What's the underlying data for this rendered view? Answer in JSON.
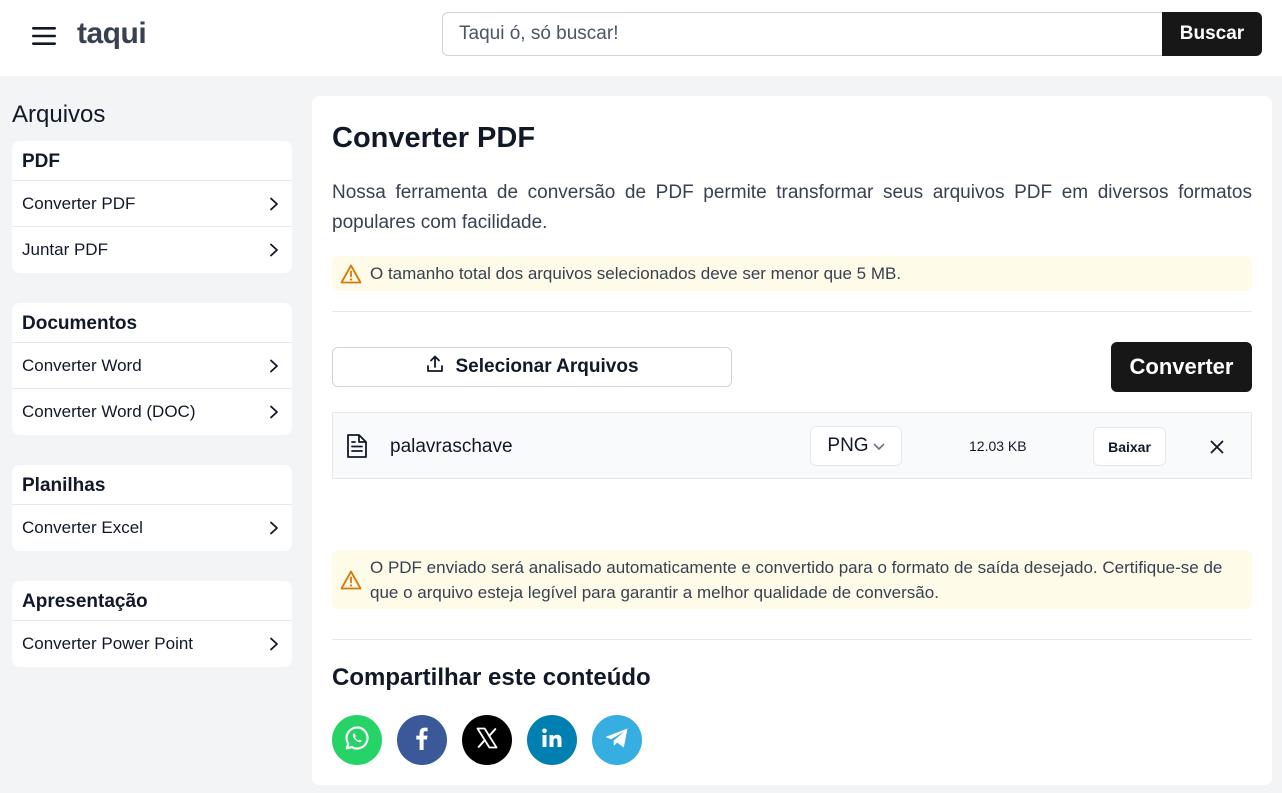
{
  "header": {
    "logo": "taqui",
    "search_placeholder": "Taqui ó, só buscar!",
    "search_button": "Buscar"
  },
  "sidebar": {
    "title": "Arquivos",
    "groups": [
      {
        "title": "PDF",
        "items": [
          "Converter PDF",
          "Juntar PDF"
        ]
      },
      {
        "title": "Documentos",
        "items": [
          "Converter Word",
          "Converter Word (DOC)"
        ]
      },
      {
        "title": "Planilhas",
        "items": [
          "Converter Excel"
        ]
      },
      {
        "title": "Apresentação",
        "items": [
          "Converter Power Point"
        ]
      }
    ]
  },
  "main": {
    "title": "Converter PDF",
    "description": "Nossa ferramenta de conversão de PDF permite transformar seus arquivos PDF em diversos formatos populares com facilidade.",
    "size_warning": "O tamanho total dos arquivos selecionados deve ser menor que 5 MB.",
    "select_button": "Selecionar Arquivos",
    "convert_button": "Converter",
    "file": {
      "name": "palavraschave",
      "format": "PNG",
      "size": "12.03 KB",
      "download_button": "Baixar"
    },
    "info_warning": "O PDF enviado será analisado automaticamente e convertido para o formato de saída desejado. Certifique-se de que o arquivo esteja legível para garantir a melhor qualidade de conversão.",
    "share_title": "Compartilhar este conteúdo",
    "share": [
      {
        "icon": "whatsapp-icon",
        "color": "#25d366"
      },
      {
        "icon": "facebook-icon",
        "color": "#3b5998"
      },
      {
        "icon": "x-icon",
        "color": "#000000"
      },
      {
        "icon": "linkedin-icon",
        "color": "#007fb1"
      },
      {
        "icon": "telegram-icon",
        "color": "#37aee2"
      }
    ]
  },
  "colors": {
    "accent": "#171717",
    "warning_bg": "#fefce8",
    "warning_icon": "#d97706"
  }
}
